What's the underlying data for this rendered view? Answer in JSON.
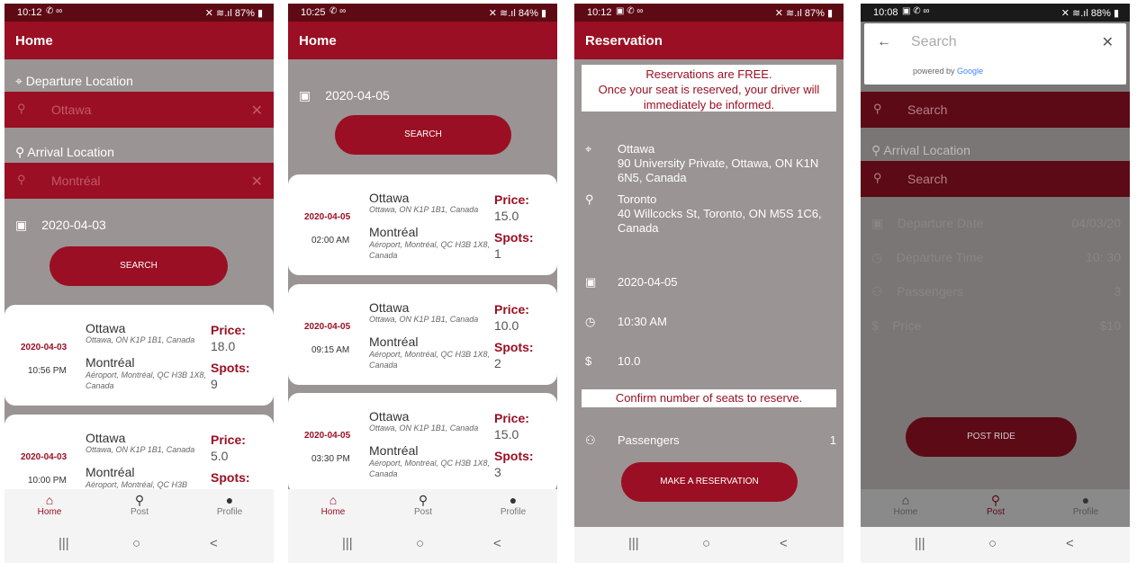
{
  "colors": {
    "accent": "#9a0f23",
    "background": "#9a9494",
    "status": "#5e0a14"
  },
  "sys_nav": {
    "recents": "|||",
    "home": "○",
    "back": "<"
  },
  "icons": {
    "search": "⚲",
    "clear": "✕",
    "back_arrow": "←",
    "calendar": "▣",
    "location": "⌖",
    "pin": "⬤",
    "clock": "◷",
    "money": "$",
    "people": "⚇"
  },
  "screens": [
    {
      "status_time": "10:12",
      "status_right": "87%",
      "title": "Home",
      "departure_label": "Departure Location",
      "departure_value": "Ottawa",
      "arrival_label": "Arrival Location",
      "arrival_value": "Montréal",
      "date": "2020-04-03",
      "search_btn": "SEARCH",
      "rides": [
        {
          "date": "2020-04-03",
          "time": "10:56 PM",
          "from": "Ottawa",
          "from_addr": "Ottawa, ON K1P 1B1, Canada",
          "to": "Montréal",
          "to_addr": "Aéroport, Montréal, QC H3B 1X8, Canada",
          "price_label": "Price:",
          "price": "18.0",
          "spots_label": "Spots:",
          "spots": "9"
        },
        {
          "date": "2020-04-03",
          "time": "10:00 PM",
          "from": "Ottawa",
          "from_addr": "Ottawa, ON K1P 1B1, Canada",
          "to": "Montréal",
          "to_addr": "Aéroport, Montréal, QC H3B",
          "price_label": "Price:",
          "price": "5.0",
          "spots_label": "Spots:",
          "spots": ""
        }
      ],
      "nav": {
        "home": "Home",
        "post": "Post",
        "profile": "Profile"
      }
    },
    {
      "status_time": "10:25",
      "status_right": "84%",
      "title": "Home",
      "date": "2020-04-05",
      "search_btn": "SEARCH",
      "rides": [
        {
          "date": "2020-04-05",
          "time": "02:00 AM",
          "from": "Ottawa",
          "from_addr": "Ottawa, ON K1P 1B1, Canada",
          "to": "Montréal",
          "to_addr": "Aéroport, Montréal, QC H3B 1X8, Canada",
          "price_label": "Price:",
          "price": "15.0",
          "spots_label": "Spots:",
          "spots": "1"
        },
        {
          "date": "2020-04-05",
          "time": "09:15 AM",
          "from": "Ottawa",
          "from_addr": "Ottawa, ON K1P 1B1, Canada",
          "to": "Montréal",
          "to_addr": "Aéroport, Montréal, QC H3B 1X8, Canada",
          "price_label": "Price:",
          "price": "10.0",
          "spots_label": "Spots:",
          "spots": "2"
        },
        {
          "date": "2020-04-05",
          "time": "03:30 PM",
          "from": "Ottawa",
          "from_addr": "Ottawa, ON K1P 1B1, Canada",
          "to": "Montréal",
          "to_addr": "Aéroport, Montréal, QC H3B 1X8, Canada",
          "price_label": "Price:",
          "price": "15.0",
          "spots_label": "Spots:",
          "spots": "3"
        }
      ],
      "nav": {
        "home": "Home",
        "post": "Post",
        "profile": "Profile"
      }
    },
    {
      "status_time": "10:12",
      "status_right": "87%",
      "title": "Reservation",
      "notice_1": "Reservations are FREE.",
      "notice_2": "Once your seat is reserved, your driver will",
      "notice_3": "immediately be informed.",
      "from_city": "Ottawa",
      "from_addr": "90 University Private, Ottawa, ON K1N 6N5, Canada",
      "to_city": "Toronto",
      "to_addr": "40 Willcocks St, Toronto, ON M5S 1C6, Canada",
      "date": "2020-04-05",
      "time": "10:30 AM",
      "price": "10.0",
      "confirm": "Confirm number of seats to reserve.",
      "passengers_label": "Passengers",
      "passengers_value": "1",
      "reserve_btn": "MAKE A RESERVATION"
    },
    {
      "status_time": "10:08",
      "status_right": "88%",
      "search_placeholder": "Search",
      "powered_by": "powered by",
      "google": "Google",
      "search_1": "Search",
      "arrival_label": "Arrival Location",
      "search_2": "Search",
      "fields": [
        {
          "label": "Departure Date",
          "value": "04/03/20"
        },
        {
          "label": "Departure Time",
          "value": "10: 30"
        },
        {
          "label": "Passengers",
          "value": "3"
        },
        {
          "label": "Price",
          "value": "$10"
        }
      ],
      "post_btn": "POST RIDE",
      "nav": {
        "home": "Home",
        "post": "Post",
        "profile": "Profile"
      }
    }
  ]
}
